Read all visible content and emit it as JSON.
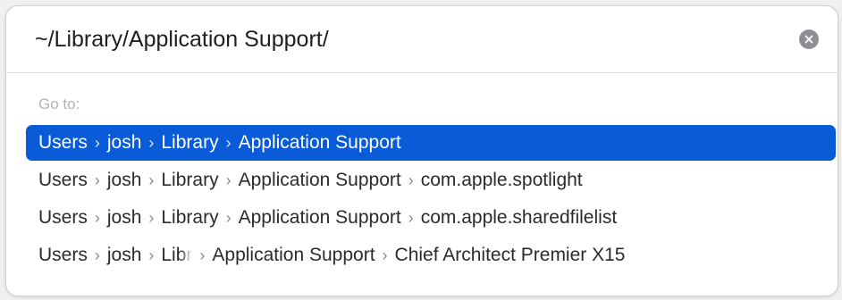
{
  "search": {
    "value": "~/Library/Application Support/",
    "clear_icon": "close-circle-icon"
  },
  "goto": {
    "label": "Go to:"
  },
  "colors": {
    "selected_background": "#0a5bd8",
    "selected_text": "#ffffff",
    "label_gray": "#b3b3b3"
  },
  "separator": "›",
  "results": [
    {
      "selected": true,
      "segments": [
        "Users",
        "josh",
        "Library",
        "Application Support"
      ]
    },
    {
      "selected": false,
      "segments": [
        "Users",
        "josh",
        "Library",
        "Application Support",
        "com.apple.spotlight"
      ]
    },
    {
      "selected": false,
      "segments": [
        "Users",
        "josh",
        "Library",
        "Application Support",
        "com.apple.sharedfilelist"
      ]
    },
    {
      "selected": false,
      "segments": [
        "Users",
        "josh",
        "Libr",
        "Application Support",
        "Chief Architect Premier X15"
      ]
    }
  ]
}
